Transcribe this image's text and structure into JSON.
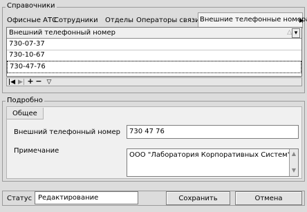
{
  "directories": {
    "title": "Справочники",
    "tabs": [
      "Офисные АТС",
      "Сотрудники",
      "Отделы",
      "Операторы связи",
      "Внешние телефонные номера"
    ],
    "active_tab": 4,
    "column_header": "Внешний телефонный номер",
    "rows": [
      "730-07-37",
      "730-10-67",
      "730-47-76"
    ],
    "nav": {
      "first": "|◀",
      "last": "▶|",
      "add": "+",
      "remove": "−",
      "filter": "▽"
    }
  },
  "details": {
    "title": "Подробно",
    "tab": "Общее",
    "phone_label": "Внешний телефонный номер",
    "phone_value": "730 47 76",
    "note_label": "Примечание",
    "note_value": "ООО \"Лаборатория Корпоративных Систем\""
  },
  "statusbar": {
    "status_label": "Статус",
    "status_value": "Редактирование",
    "save_label": "Сохранить",
    "cancel_label": "Отмена"
  }
}
